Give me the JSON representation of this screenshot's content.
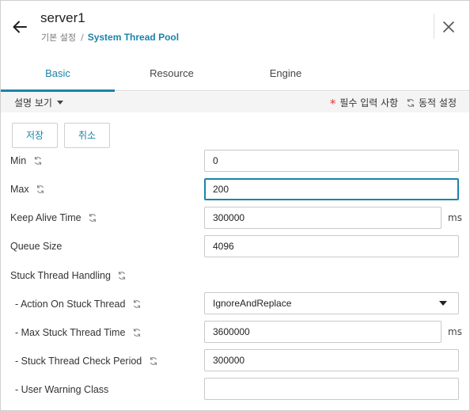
{
  "header": {
    "title": "server1",
    "breadcrumb_parent": "기본 설정",
    "breadcrumb_separator": "/",
    "breadcrumb_current": "System Thread Pool"
  },
  "tabs": [
    {
      "label": "Basic",
      "active": true
    },
    {
      "label": "Resource",
      "active": false
    },
    {
      "label": "Engine",
      "active": false
    }
  ],
  "toolbar": {
    "description_toggle": "설명 보기",
    "required_marker": "*",
    "required_label": "필수 입력 사항",
    "dynamic_label": "동적 설정"
  },
  "actions": {
    "save_label": "저장",
    "cancel_label": "취소"
  },
  "form": {
    "min": {
      "label": "Min",
      "value": "0"
    },
    "max": {
      "label": "Max",
      "value": "200"
    },
    "keep_alive_time": {
      "label": "Keep Alive Time",
      "value": "300000",
      "unit": "ms"
    },
    "queue_size": {
      "label": "Queue Size",
      "value": "4096"
    },
    "stuck_thread_handling": {
      "label": "Stuck Thread Handling"
    },
    "action_on_stuck_thread": {
      "label": "- Action On Stuck Thread",
      "value": "IgnoreAndReplace"
    },
    "max_stuck_thread_time": {
      "label": "- Max Stuck Thread Time",
      "value": "3600000",
      "unit": "ms"
    },
    "stuck_thread_check_period": {
      "label": "- Stuck Thread Check Period",
      "value": "300000"
    },
    "user_warning_class": {
      "label": "- User Warning Class",
      "value": ""
    }
  },
  "colors": {
    "accent": "#1a84a8",
    "required_star": "#e53935",
    "toolbar_bg": "#f4f4f4"
  },
  "icons": {
    "back": "arrow-left-icon",
    "close": "close-x-icon",
    "dynamic": "sync-icon"
  }
}
